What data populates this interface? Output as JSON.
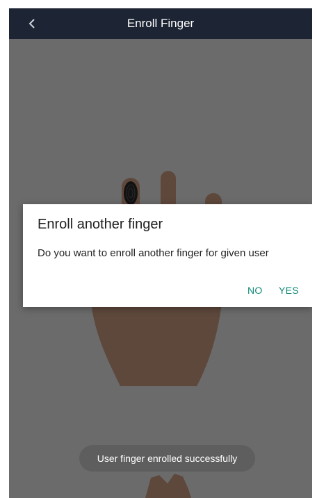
{
  "toolbar": {
    "title": "Enroll Finger",
    "back_icon": "chevron-left-icon",
    "background": "#1d2433"
  },
  "dialog": {
    "title": "Enroll another finger",
    "message": "Do you want to enroll another finger for given user",
    "negative_label": "NO",
    "positive_label": "YES",
    "accent_color": "#0f8a76"
  },
  "toast": {
    "text": "User finger enrolled successfully"
  },
  "illustration": {
    "hands_icon": "hand-fingerprint-icon"
  }
}
